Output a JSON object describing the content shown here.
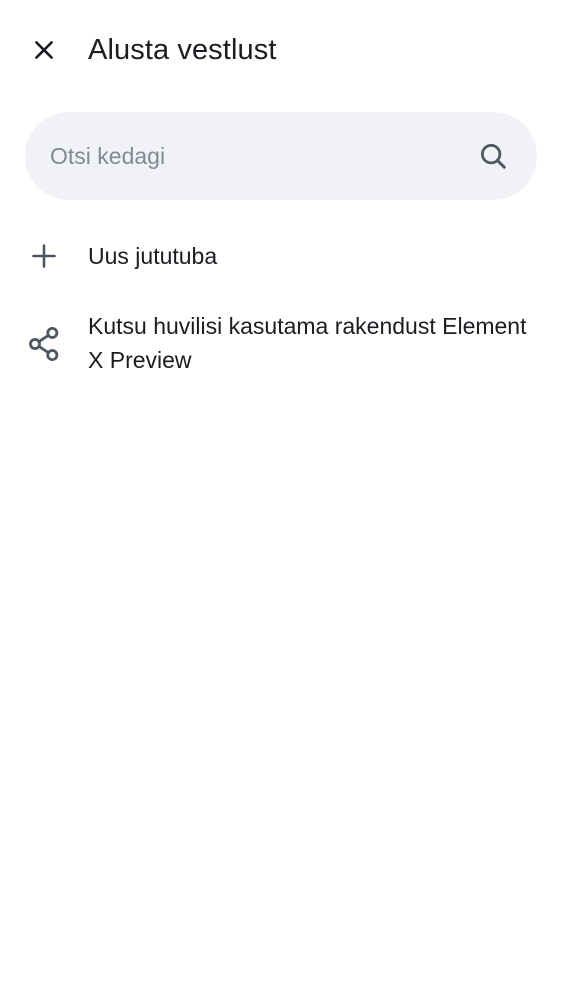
{
  "header": {
    "title": "Alusta vestlust",
    "close_icon": "close-icon"
  },
  "search": {
    "placeholder": "Otsi kedagi",
    "value": "",
    "icon": "search-icon"
  },
  "list": {
    "items": [
      {
        "label": "Uus jututuba",
        "icon": "plus-icon"
      },
      {
        "label": "Kutsu huvilisi kasutama rakendust Element X Preview",
        "icon": "share-icon"
      }
    ]
  },
  "colors": {
    "background": "#ffffff",
    "search_background": "#f0f2f5",
    "text_primary": "#1b1d22",
    "text_secondary": "#818a95",
    "icon": "#4f5561"
  }
}
